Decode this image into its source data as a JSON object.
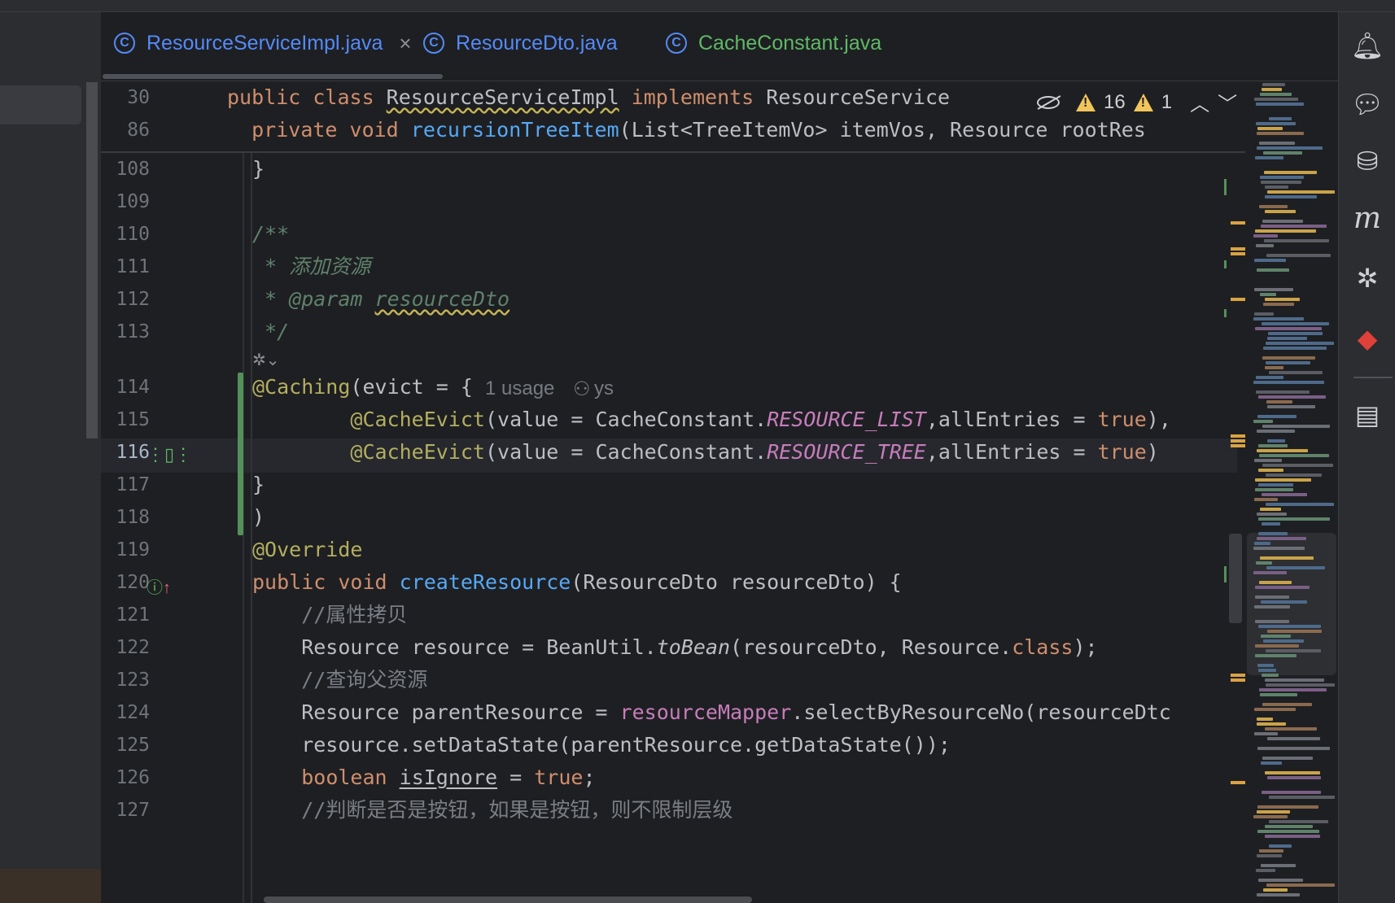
{
  "tabs": [
    {
      "label": "ResourceServiceImpl.java",
      "icon": "class-icon",
      "color": "#548af7",
      "active": true,
      "closable": true
    },
    {
      "label": "ResourceDto.java",
      "icon": "class-icon",
      "color": "#548af7",
      "active": false
    },
    {
      "label": "CacheConstant.java",
      "icon": "class-icon",
      "color": "#5fb865",
      "active": false
    }
  ],
  "inspection": {
    "warnings": "16",
    "weak_warnings": "1"
  },
  "sticky_lines": [
    {
      "num": "30",
      "parts": [
        [
          "kw",
          "public class "
        ],
        [
          "wavy",
          "ResourceServiceImpl"
        ],
        [
          "kw",
          " implements "
        ],
        [
          "",
          "ResourceService"
        ]
      ]
    },
    {
      "num": "86",
      "parts": [
        [
          "",
          "  "
        ],
        [
          "kw",
          "private void "
        ],
        [
          "fn",
          "recursionTreeItem"
        ],
        [
          "",
          "(List<TreeItemVo> itemVos, Resource rootRes"
        ]
      ]
    }
  ],
  "hints": {
    "usage": "1 usage",
    "author": "ys"
  },
  "lines": [
    {
      "num": "108",
      "indent": 0,
      "parts": [
        [
          "",
          "}"
        ]
      ]
    },
    {
      "num": "109",
      "indent": 0,
      "parts": []
    },
    {
      "num": "110",
      "indent": 0,
      "parts": [
        [
          "doc",
          "/**"
        ]
      ]
    },
    {
      "num": "111",
      "indent": 0,
      "parts": [
        [
          "doc",
          " * 添加资源"
        ]
      ]
    },
    {
      "num": "112",
      "indent": 0,
      "parts": [
        [
          "doc",
          " * @param "
        ],
        [
          "docwavy",
          "resourceDto"
        ]
      ]
    },
    {
      "num": "113",
      "indent": 0,
      "parts": [
        [
          "doc",
          " */"
        ]
      ]
    },
    {
      "num": "114",
      "indent": 0,
      "parts": [
        [
          "ann",
          "@Caching"
        ],
        [
          "",
          "(evict = {"
        ]
      ]
    },
    {
      "num": "115",
      "indent": 0,
      "parts": [
        [
          "",
          "        "
        ],
        [
          "ann",
          "@CacheEvict"
        ],
        [
          "",
          "(value = CacheConstant."
        ],
        [
          "const",
          "RESOURCE_LIST"
        ],
        [
          "",
          ",allEntries = "
        ],
        [
          "kw",
          "true"
        ],
        [
          "",
          "),"
        ]
      ]
    },
    {
      "num": "116",
      "indent": 0,
      "parts": [
        [
          "",
          "        "
        ],
        [
          "ann",
          "@CacheEvict"
        ],
        [
          "",
          "(value = CacheConstant."
        ],
        [
          "const",
          "RESOURCE_TREE"
        ],
        [
          "",
          ",allEntries = "
        ],
        [
          "kw",
          "true"
        ],
        [
          "",
          ")"
        ]
      ]
    },
    {
      "num": "117",
      "indent": 0,
      "parts": [
        [
          "",
          "}"
        ]
      ]
    },
    {
      "num": "118",
      "indent": 0,
      "parts": [
        [
          "",
          ")"
        ]
      ]
    },
    {
      "num": "119",
      "indent": 0,
      "parts": [
        [
          "ann",
          "@Override"
        ]
      ]
    },
    {
      "num": "120",
      "indent": 0,
      "parts": [
        [
          "kw",
          "public void "
        ],
        [
          "fn",
          "createResource"
        ],
        [
          "",
          "(ResourceDto resourceDto) {"
        ]
      ]
    },
    {
      "num": "121",
      "indent": 0,
      "parts": [
        [
          "",
          "    "
        ],
        [
          "cmt",
          "//属性拷贝"
        ]
      ]
    },
    {
      "num": "122",
      "indent": 0,
      "parts": [
        [
          "",
          "    Resource resource = BeanUtil."
        ],
        [
          "ital",
          "toBean"
        ],
        [
          "",
          "(resourceDto, Resource."
        ],
        [
          "kw",
          "class"
        ],
        [
          "",
          ");"
        ]
      ]
    },
    {
      "num": "123",
      "indent": 0,
      "parts": [
        [
          "",
          "    "
        ],
        [
          "cmt",
          "//查询父资源"
        ]
      ]
    },
    {
      "num": "124",
      "indent": 0,
      "parts": [
        [
          "",
          "    Resource parentResource = "
        ],
        [
          "field",
          "resourceMapper"
        ],
        [
          "",
          ".selectByResourceNo(resourceDtc"
        ]
      ]
    },
    {
      "num": "125",
      "indent": 0,
      "parts": [
        [
          "",
          "    resource.setDataState(parentResource.getDataState());"
        ]
      ]
    },
    {
      "num": "126",
      "indent": 0,
      "parts": [
        [
          "",
          "    "
        ],
        [
          "kw",
          "boolean "
        ],
        [
          "uline",
          "isIgnore"
        ],
        [
          "",
          " = "
        ],
        [
          "kw",
          "true"
        ],
        [
          "",
          ";"
        ]
      ]
    },
    {
      "num": "127",
      "indent": 0,
      "parts": [
        [
          "",
          "    "
        ],
        [
          "cmt",
          "//判断是否是按钮，如果是按钮，则不限制层级"
        ]
      ]
    }
  ],
  "sidebar_icons": [
    "notifications-icon",
    "ai-chat-icon",
    "database-icon",
    "maven-icon",
    "plugin-icon",
    "bird-icon",
    "translate-icon"
  ]
}
